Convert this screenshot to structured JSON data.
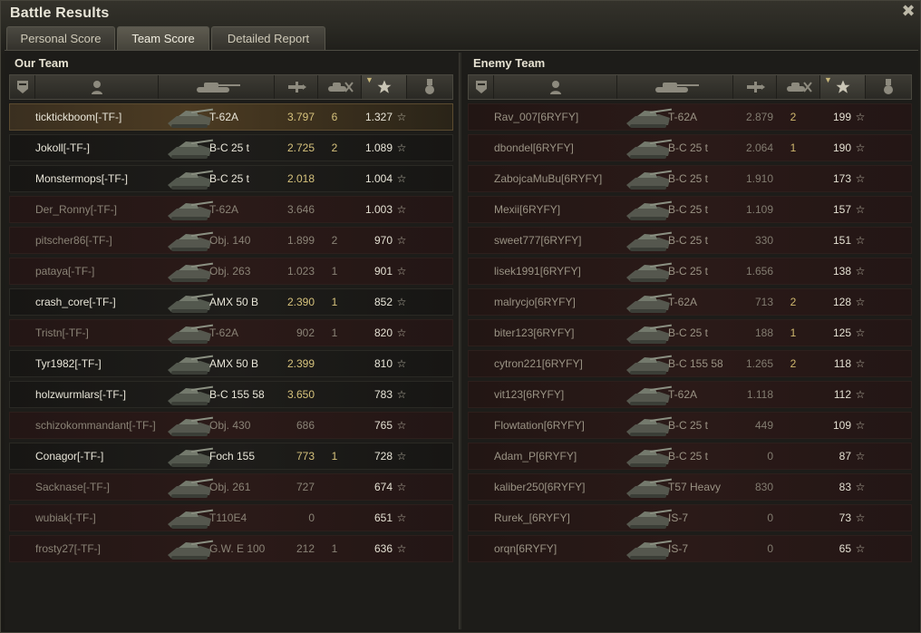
{
  "window": {
    "title": "Battle Results",
    "close_icon": "close-icon"
  },
  "tabs": [
    {
      "label": "Personal Score",
      "active": false
    },
    {
      "label": "Team Score",
      "active": true
    },
    {
      "label": "Detailed Report",
      "active": false
    }
  ],
  "columns": {
    "icons": [
      "squad-icon",
      "player-icon",
      "tank-icon",
      "damage-icon",
      "kills-icon",
      "xp-star-icon",
      "medal-icon"
    ],
    "sorted_by": "xp"
  },
  "our_team": {
    "title": "Our Team",
    "rows": [
      {
        "name": "ticktickboom[-TF-]",
        "tank": "T-62A",
        "damage": "3.797",
        "kills": "6",
        "xp": "1.327",
        "state": "highlight"
      },
      {
        "name": "Jokoll[-TF-]",
        "tank": "B-C 25 t",
        "damage": "2.725",
        "kills": "2",
        "xp": "1.089",
        "state": "alive"
      },
      {
        "name": "Monstermops[-TF-]",
        "tank": "B-C 25 t",
        "damage": "2.018",
        "kills": "",
        "xp": "1.004",
        "state": "alive"
      },
      {
        "name": "Der_Ronny[-TF-]",
        "tank": "T-62A",
        "damage": "3.646",
        "kills": "",
        "xp": "1.003",
        "state": "dead"
      },
      {
        "name": "pitscher86[-TF-]",
        "tank": "Obj. 140",
        "damage": "1.899",
        "kills": "2",
        "xp": "970",
        "state": "dead"
      },
      {
        "name": "pataya[-TF-]",
        "tank": "Obj. 263",
        "damage": "1.023",
        "kills": "1",
        "xp": "901",
        "state": "dead"
      },
      {
        "name": "crash_core[-TF-]",
        "tank": "AMX 50 B",
        "damage": "2.390",
        "kills": "1",
        "xp": "852",
        "state": "alive"
      },
      {
        "name": "Tristn[-TF-]",
        "tank": "T-62A",
        "damage": "902",
        "kills": "1",
        "xp": "820",
        "state": "dead"
      },
      {
        "name": "Tyr1982[-TF-]",
        "tank": "AMX 50 B",
        "damage": "2.399",
        "kills": "",
        "xp": "810",
        "state": "alive"
      },
      {
        "name": "holzwurmlars[-TF-]",
        "tank": "B-C 155 58",
        "damage": "3.650",
        "kills": "",
        "xp": "783",
        "state": "alive"
      },
      {
        "name": "schizokommandant[-TF-]",
        "tank": "Obj. 430",
        "damage": "686",
        "kills": "",
        "xp": "765",
        "state": "dead"
      },
      {
        "name": "Conagor[-TF-]",
        "tank": "Foch 155",
        "damage": "773",
        "kills": "1",
        "xp": "728",
        "state": "alive"
      },
      {
        "name": "Sacknase[-TF-]",
        "tank": "Obj. 261",
        "damage": "727",
        "kills": "",
        "xp": "674",
        "state": "dead"
      },
      {
        "name": "wubiak[-TF-]",
        "tank": "T110E4",
        "damage": "0",
        "kills": "",
        "xp": "651",
        "state": "dead"
      },
      {
        "name": "frosty27[-TF-]",
        "tank": "G.W. E 100",
        "damage": "212",
        "kills": "1",
        "xp": "636",
        "state": "dead"
      }
    ]
  },
  "enemy_team": {
    "title": "Enemy Team",
    "rows": [
      {
        "name": "Rav_007[6RYFY]",
        "tank": "T-62A",
        "damage": "2.879",
        "kills": "2",
        "xp": "199"
      },
      {
        "name": "dbondel[6RYFY]",
        "tank": "B-C 25 t",
        "damage": "2.064",
        "kills": "1",
        "xp": "190"
      },
      {
        "name": "ZabojcaMuBu[6RYFY]",
        "tank": "B-C 25 t",
        "damage": "1.910",
        "kills": "",
        "xp": "173"
      },
      {
        "name": "Mexii[6RYFY]",
        "tank": "B-C 25 t",
        "damage": "1.109",
        "kills": "",
        "xp": "157"
      },
      {
        "name": "sweet777[6RYFY]",
        "tank": "B-C 25 t",
        "damage": "330",
        "kills": "",
        "xp": "151"
      },
      {
        "name": "lisek1991[6RYFY]",
        "tank": "B-C 25 t",
        "damage": "1.656",
        "kills": "",
        "xp": "138"
      },
      {
        "name": "malrycjo[6RYFY]",
        "tank": "T-62A",
        "damage": "713",
        "kills": "2",
        "xp": "128"
      },
      {
        "name": "biter123[6RYFY]",
        "tank": "B-C 25 t",
        "damage": "188",
        "kills": "1",
        "xp": "125"
      },
      {
        "name": "cytron221[6RYFY]",
        "tank": "B-C 155 58",
        "damage": "1.265",
        "kills": "2",
        "xp": "118"
      },
      {
        "name": "vit123[6RYFY]",
        "tank": "T-62A",
        "damage": "1.118",
        "kills": "",
        "xp": "112"
      },
      {
        "name": "Flowtation[6RYFY]",
        "tank": "B-C 25 t",
        "damage": "449",
        "kills": "",
        "xp": "109"
      },
      {
        "name": "Adam_P[6RYFY]",
        "tank": "B-C 25 t",
        "damage": "0",
        "kills": "",
        "xp": "87"
      },
      {
        "name": "kaliber250[6RYFY]",
        "tank": "T57 Heavy",
        "damage": "830",
        "kills": "",
        "xp": "83"
      },
      {
        "name": "Rurek_[6RYFY]",
        "tank": "IS-7",
        "damage": "0",
        "kills": "",
        "xp": "73"
      },
      {
        "name": "orqn[6RYFY]",
        "tank": "IS-7",
        "damage": "0",
        "kills": "",
        "xp": "65"
      }
    ]
  },
  "colors": {
    "gold_value": "#d6c27c",
    "highlight_row": "#4c3b22",
    "dead_row": "#2b1a18"
  }
}
